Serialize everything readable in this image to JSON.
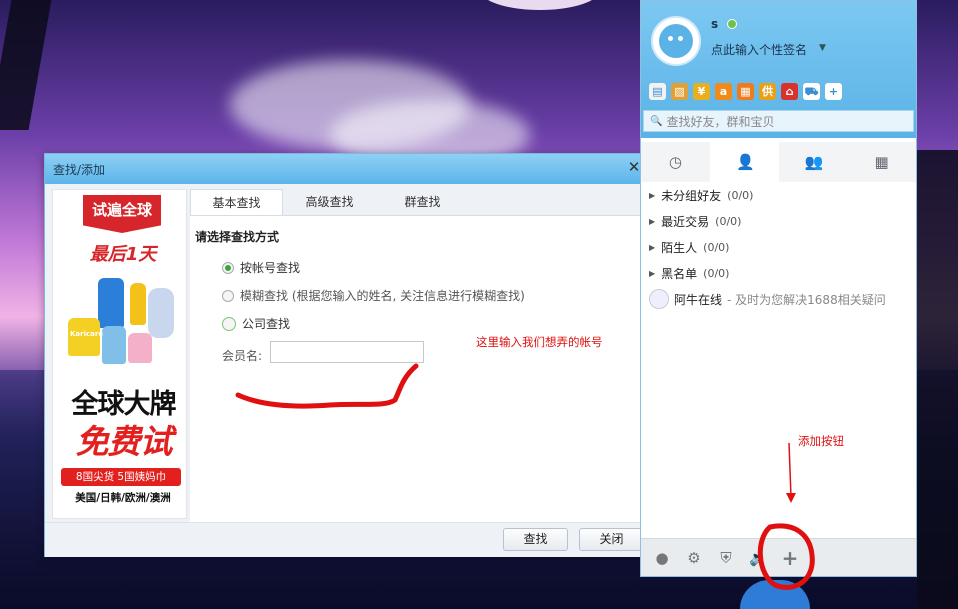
{
  "dialog": {
    "title": "查找/添加",
    "close_glyph": "✕",
    "tabs": [
      "基本查找",
      "高级查找",
      "群查找"
    ],
    "heading": "请选择查找方式",
    "options": [
      {
        "label": "按帐号查找",
        "selected": true
      },
      {
        "label": "模糊查找 (根据您输入的姓名, 关注信息进行模糊查找)",
        "selected": false
      },
      {
        "label": "公司查找",
        "selected": false
      }
    ],
    "member_label": "会员名:",
    "member_value": "",
    "search_button": "查找",
    "close_button": "关闭"
  },
  "ad": {
    "banner": "试遍全球",
    "last_day": "最后1天",
    "headline1": "全球大牌",
    "headline2": "免费试",
    "subline": "8国尖货 5国姨妈巾",
    "regions": "美国/日韩/欧洲/澳洲",
    "brand_text": "Karicare"
  },
  "panel": {
    "nickname": "s",
    "signature": "点此输入个性签名",
    "signature_arrow": "▼",
    "search_placeholder": "查找好友，群和宝贝",
    "search_icon": "🔍",
    "groups": [
      {
        "name": "未分组好友",
        "count": "(0/0)"
      },
      {
        "name": "最近交易",
        "count": "(0/0)"
      },
      {
        "name": "陌生人",
        "count": "(0/0)"
      },
      {
        "name": "黑名单",
        "count": "(0/0)"
      }
    ],
    "contact": {
      "name": "阿牛在线",
      "desc": "- 及时为您解决1688相关疑问"
    },
    "tools": [
      {
        "icon": "calendar-icon",
        "glyph": "▤",
        "color": "#f2f2f2"
      },
      {
        "icon": "photo-icon",
        "glyph": "▨",
        "color": "#e2a034"
      },
      {
        "icon": "money-bag-icon",
        "glyph": "¥",
        "color": "#e8b020"
      },
      {
        "icon": "alibaba-icon",
        "glyph": "a",
        "color": "#f08a1a"
      },
      {
        "icon": "grid-icon",
        "glyph": "▦",
        "color": "#f07b1c"
      },
      {
        "icon": "supply-icon",
        "glyph": "供",
        "color": "#e8a018"
      },
      {
        "icon": "shop-icon",
        "glyph": "⌂",
        "color": "#d8322c"
      },
      {
        "icon": "cart-icon",
        "glyph": "⛟",
        "color": "#ffffff"
      },
      {
        "icon": "add-icon",
        "glyph": "+",
        "color": "#ffffff"
      }
    ],
    "nav_tabs": [
      {
        "icon": "clock-icon",
        "glyph": "◷"
      },
      {
        "icon": "contacts-icon",
        "glyph": "👤"
      },
      {
        "icon": "group-icon",
        "glyph": "👥"
      },
      {
        "icon": "apps-icon",
        "glyph": "▦"
      }
    ],
    "footer_icons": [
      {
        "icon": "mascot-icon",
        "glyph": "●"
      },
      {
        "icon": "settings-icon",
        "glyph": "⚙"
      },
      {
        "icon": "shield-icon",
        "glyph": "⛨"
      },
      {
        "icon": "speaker-icon",
        "glyph": "🔈"
      },
      {
        "icon": "add-plus-icon",
        "glyph": "+"
      }
    ]
  },
  "annotations": {
    "input_hint": "这里输入我们想弄的帐号",
    "add_button_hint": "添加按钮"
  },
  "colors": {
    "accent_blue": "#5ab2e6",
    "annotation_red": "#e01010",
    "online_green": "#6ac445"
  }
}
